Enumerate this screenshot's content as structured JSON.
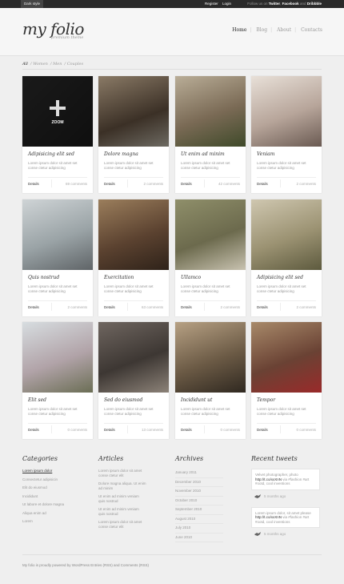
{
  "topbar": {
    "style_tab": "Dark style",
    "register": "Register",
    "login": "Login",
    "follow_prefix": "Follow us on",
    "twitter": "Twitter",
    "facebook": "Facebook",
    "and": "and",
    "dribbble": "Dribbble"
  },
  "header": {
    "logo": "my folio",
    "tagline": "premium theme",
    "nav": [
      "Home",
      "Blog",
      "About",
      "Contacts"
    ]
  },
  "filters": [
    "All",
    "Women",
    "Men",
    "Couples"
  ],
  "cards": [
    {
      "title": "Adipisicing elit sed",
      "desc": "Lorem ipsum dolor sit amet set conse ctetur adipisicing",
      "details": "Details",
      "comments": "69 comments"
    },
    {
      "title": "Dolore magna",
      "desc": "Lorem ipsum dolor sit amet set conse ctetur adipisicing",
      "details": "Details",
      "comments": "2 comments"
    },
    {
      "title": "Ut enim ad minim",
      "desc": "Lorem ipsum dolor sit amet set conse ctetur adipisicing",
      "details": "Details",
      "comments": "42 comments"
    },
    {
      "title": "Veniam",
      "desc": "Lorem ipsum dolor sit amet set conse ctetur adipisicing",
      "details": "Details",
      "comments": "2 comments"
    },
    {
      "title": "Quis nostrud",
      "desc": "Lorem ipsum dolor sit amet set conse ctetur adipisicing",
      "details": "Details",
      "comments": "2 comments"
    },
    {
      "title": "Exercitation",
      "desc": "Lorem ipsum dolor sit amet set conse ctetur adipisicing",
      "details": "Details",
      "comments": "63 comments"
    },
    {
      "title": "Ullamco",
      "desc": "Lorem ipsum dolor sit amet set conse ctetur adipisicing",
      "details": "Details",
      "comments": "2 comments"
    },
    {
      "title": "Adipisicing elit sed",
      "desc": "Lorem ipsum dolor sit amet set conse ctetur adipisicing",
      "details": "Details",
      "comments": "2 comments"
    },
    {
      "title": "Elit sed",
      "desc": "Lorem ipsum dolor sit amet set conse ctetur adipisicing",
      "details": "Details",
      "comments": "0 comments"
    },
    {
      "title": "Sed do eiusmod",
      "desc": "Lorem ipsum dolor sit amet set conse ctetur adipisicing",
      "details": "Details",
      "comments": "13 comments"
    },
    {
      "title": "Incididunt ut",
      "desc": "Lorem ipsum dolor sit amet set conse ctetur adipisicing",
      "details": "Details",
      "comments": "0 comments"
    },
    {
      "title": "Tempor",
      "desc": "Lorem ipsum dolor sit amet set conse ctetur adipisicing",
      "details": "Details",
      "comments": "0 comments"
    }
  ],
  "zoom_label": "ZOOM",
  "footer": {
    "categories": {
      "title": "Categories",
      "items": [
        "Lorem ipsum dolor",
        "Consectetur adipisicin",
        "Elit do eiusmod",
        "Incididunt",
        "Ut labore et dolore magna",
        "Aliqua enim ad",
        "Lorem"
      ]
    },
    "articles": {
      "title": "Articles",
      "items": [
        "Lorem ipsum dolor sit amet conse ctetur elit",
        "Dolore magna aliqua. Ut enim ad minim",
        "Ut enim ad minim veniam quis nostrud",
        "Ut enim ad minim veniam quis nostrud",
        "Lorem ipsum dolor sit amet conse ctetur elit"
      ]
    },
    "archives": {
      "title": "Archives",
      "items": [
        "January 2011",
        "December 2010",
        "November 2010",
        "October 2010",
        "September 2010",
        "August 2010",
        "July 2010",
        "June 2010"
      ]
    },
    "tweets": {
      "title": "Recent tweets",
      "items": [
        {
          "text_before": "Velvet photographer, photo",
          "link": "http://t.co/xxXnN",
          "text_after": "via #fashion #art #ootd, cool inventions",
          "when": "5 months ago"
        },
        {
          "text_before": "Lorem ipsum dolor, sit amet please",
          "link": "http://t.co/xxXnN",
          "text_after": "via #fashion #art #ootd, cool inventions",
          "when": "5 months ago"
        }
      ]
    }
  },
  "powered": "My folio is proudly powered by WordPress  Entries (RSS) and Comments (RSS)"
}
